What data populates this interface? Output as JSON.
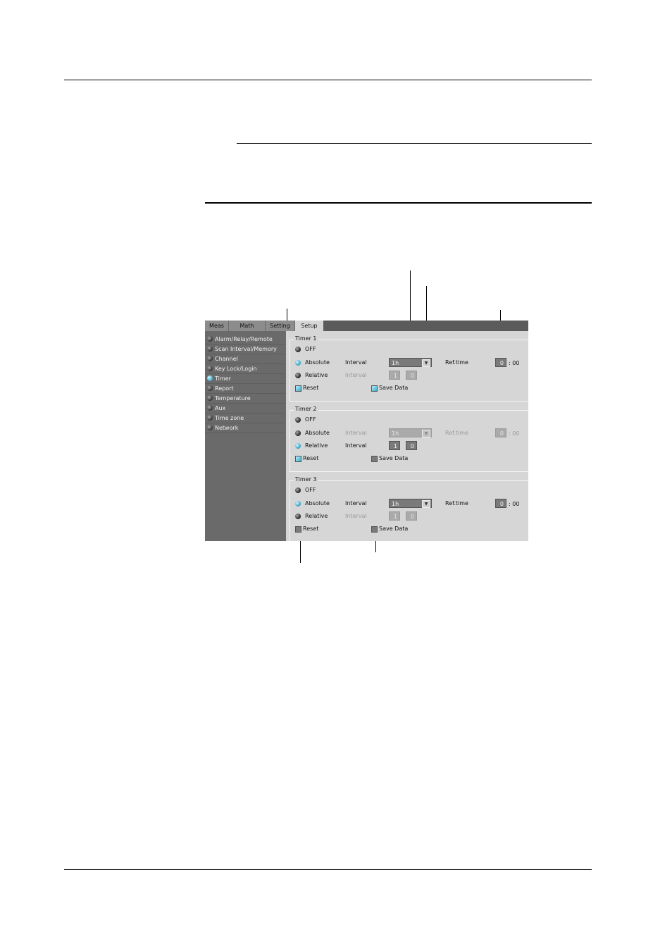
{
  "tabs": [
    {
      "label": "Meas"
    },
    {
      "label": "Math"
    },
    {
      "label": "Setting"
    },
    {
      "label": "Setup"
    }
  ],
  "active_tab": "Setup",
  "sidebar": {
    "items": [
      {
        "label": "Alarm/Relay/Remote"
      },
      {
        "label": "Scan Interval/Memory"
      },
      {
        "label": "Channel"
      },
      {
        "label": "Key Lock/Login"
      },
      {
        "label": "Timer"
      },
      {
        "label": "Report"
      },
      {
        "label": "Temperature"
      },
      {
        "label": "Aux"
      },
      {
        "label": "Time zone"
      },
      {
        "label": "Network"
      }
    ],
    "active": "Timer"
  },
  "timers": [
    {
      "title": "Timer 1",
      "modes": {
        "off": "OFF",
        "absolute": "Absolute",
        "relative": "Relative"
      },
      "selected_mode": "Absolute",
      "absolute_interval_label": "Interval",
      "absolute_interval_value": "1h",
      "ref_time_label": "Ref.time",
      "ref_time_hour": "0",
      "ref_time_min": ": 00",
      "relative_interval_label": "Interval",
      "relative_interval_hour": "1",
      "relative_interval_min": "0",
      "reset_label": "Reset",
      "reset_checked": true,
      "save_data_label": "Save Data",
      "save_data_checked": true
    },
    {
      "title": "Timer 2",
      "modes": {
        "off": "OFF",
        "absolute": "Absolute",
        "relative": "Relative"
      },
      "selected_mode": "Relative",
      "absolute_interval_label": "Interval",
      "absolute_interval_value": "1h",
      "ref_time_label": "Ref.time",
      "ref_time_hour": "0",
      "ref_time_min": ": 00",
      "relative_interval_label": "Interval",
      "relative_interval_hour": "1",
      "relative_interval_min": "0",
      "reset_label": "Reset",
      "reset_checked": true,
      "save_data_label": "Save Data",
      "save_data_checked": false
    },
    {
      "title": "Timer 3",
      "modes": {
        "off": "OFF",
        "absolute": "Absolute",
        "relative": "Relative"
      },
      "selected_mode": "Absolute",
      "absolute_interval_label": "Interval",
      "absolute_interval_value": "1h",
      "ref_time_label": "Ref.time",
      "ref_time_hour": "0",
      "ref_time_min": ": 00",
      "relative_interval_label": "Interval",
      "relative_interval_hour": "1",
      "relative_interval_min": "0",
      "reset_label": "Reset",
      "reset_checked": false,
      "save_data_label": "Save Data",
      "save_data_checked": false
    }
  ],
  "colors": {
    "selected_accent": "#3aa9c9",
    "sidebar_bg": "#6a6a6a",
    "panel_bg": "#d6d6d6",
    "tabbar_bg": "#5b5b5b"
  }
}
